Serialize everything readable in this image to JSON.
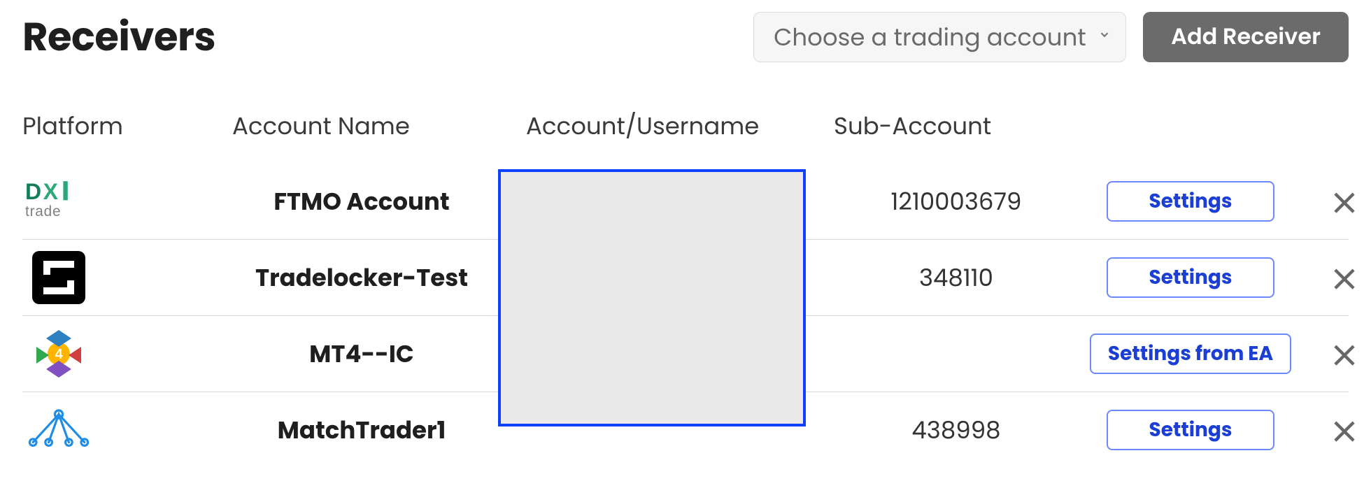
{
  "header": {
    "title": "Receivers",
    "account_select_placeholder": "Choose a trading account",
    "add_button_label": "Add Receiver"
  },
  "table": {
    "columns": {
      "platform": "Platform",
      "account_name": "Account Name",
      "account_username": "Account/Username",
      "sub_account": "Sub-Account"
    },
    "rows": [
      {
        "platform_icon": "dxtrade-icon",
        "account_name": "FTMO Account",
        "account_username": "",
        "sub_account": "1210003679",
        "settings_label": "Settings"
      },
      {
        "platform_icon": "tradelocker-icon",
        "account_name": "Tradelocker-Test",
        "account_username": "",
        "sub_account": "348110",
        "settings_label": "Settings"
      },
      {
        "platform_icon": "mt4-icon",
        "account_name": "MT4--IC",
        "account_username": "",
        "sub_account": "",
        "settings_label": "Settings from EA"
      },
      {
        "platform_icon": "matchtrader-icon",
        "account_name": "MatchTrader1",
        "account_username": "",
        "sub_account": "438998",
        "settings_label": "Settings"
      }
    ]
  },
  "redaction": {
    "column": "account_username",
    "note": "values redacted in source image"
  }
}
